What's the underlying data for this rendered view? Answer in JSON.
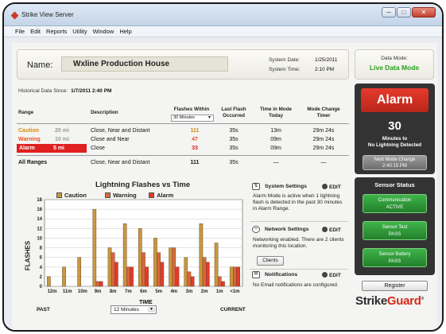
{
  "window": {
    "title": "Strike View Server",
    "min": "─",
    "max": "□",
    "close": "✕"
  },
  "menu": [
    "File",
    "Edit",
    "Reports",
    "Utility",
    "Window",
    "Help"
  ],
  "header": {
    "name_label": "Name:",
    "name_value": "Wxline Production House",
    "system_date_label": "System Date:",
    "system_date": "1/25/2011",
    "system_time_label": "System Time:",
    "system_time": "2:10 PM"
  },
  "data_mode": {
    "label": "Data Mode:",
    "value": "Live Data Mode",
    "color": "#2aa21e"
  },
  "historical": {
    "label": "Historical Data Since:",
    "value": "1/7/2011 2:40 PM"
  },
  "table": {
    "headers": {
      "range": "Range",
      "description": "Description",
      "flashes": "Flashes Within",
      "last_flash": "Last Flash Occurred",
      "time_in_mode": "Time in Mode Today",
      "mode_change": "Mode Change Timer"
    },
    "flashes_window": "30 Minutes",
    "rows": [
      {
        "name": "Caution",
        "mi": "20 mi",
        "desc": "Close, Near and Distant",
        "flashes": "111",
        "last": "35s",
        "mode": "13m",
        "timer": "29m 24s",
        "color": "#d98b0b"
      },
      {
        "name": "Warning",
        "mi": "10 mi",
        "desc": "Close and Near",
        "flashes": "47",
        "last": "35s",
        "mode": "09m",
        "timer": "29m 24s",
        "color": "#e0552a"
      },
      {
        "name": "Alarm",
        "mi": "5 mi",
        "desc": "Close",
        "flashes": "33",
        "last": "35s",
        "mode": "09m",
        "timer": "29m 24s",
        "color": "#e02020"
      }
    ],
    "all": {
      "name": "All Ranges",
      "desc": "Close, Near and Distant",
      "flashes": "111",
      "last": "35s",
      "mode": "—",
      "timer": "—"
    }
  },
  "chart_data": {
    "type": "bar",
    "title": "Lightning Flashes vs Time",
    "xlabel": "TIME",
    "ylabel": "FLASHES",
    "categories": [
      "12m",
      "11m",
      "10m",
      "9m",
      "8m",
      "7m",
      "6m",
      "5m",
      "4m",
      "3m",
      "2m",
      "1m",
      "<1m"
    ],
    "series": [
      {
        "name": "Caution",
        "color": "#c9973e",
        "values": [
          2,
          4,
          6,
          16,
          8,
          13,
          12,
          10,
          8,
          6,
          13,
          9,
          4
        ]
      },
      {
        "name": "Warning",
        "color": "#d8673a",
        "values": [
          0,
          0,
          0,
          1,
          7,
          4,
          7,
          7,
          8,
          3,
          6,
          2,
          4
        ]
      },
      {
        "name": "Alarm",
        "color": "#e53a2c",
        "values": [
          0,
          0,
          0,
          1,
          5,
          4,
          4,
          5,
          4,
          2,
          5,
          1,
          4
        ]
      }
    ],
    "ylim": [
      0,
      18
    ],
    "yticks": [
      0,
      2,
      4,
      6,
      8,
      10,
      12,
      14,
      16,
      18
    ],
    "grid": true,
    "legend": "top"
  },
  "chart_footer": {
    "past": "PAST",
    "current": "CURRENT",
    "window": "12 Minutes"
  },
  "system_settings": {
    "title": "System Settings",
    "edit": "EDIT",
    "text": "Alarm Mode is active when 1 lightning flash is detected in the past 30 minutes in Alarm Range."
  },
  "network_settings": {
    "title": "Network Settings",
    "edit": "EDIT",
    "text": "Networking enabled.  There are 2 clients monitoring this location.",
    "clients_button": "Clients"
  },
  "notifications": {
    "title": "Notifications",
    "edit": "EDIT",
    "text": "No Email notifications are configured."
  },
  "alarm_panel": {
    "status": "Alarm",
    "minutes": "30",
    "minutes_text_1": "Minutes to",
    "minutes_text_2": "No Lightning Detected",
    "next_label": "Next Mode Change",
    "next_time": "2:40:15 PM"
  },
  "sensor_status": {
    "title": "Sensor Status",
    "items": [
      {
        "label": "Communication",
        "value": "ACTIVE"
      },
      {
        "label": "Sensor Test",
        "value": "PASS"
      },
      {
        "label": "Sensor Battery",
        "value": "PASS"
      }
    ]
  },
  "register_button": "Register",
  "logo": {
    "part1": "Strike",
    "part2": "Guard",
    "mark": "®"
  }
}
